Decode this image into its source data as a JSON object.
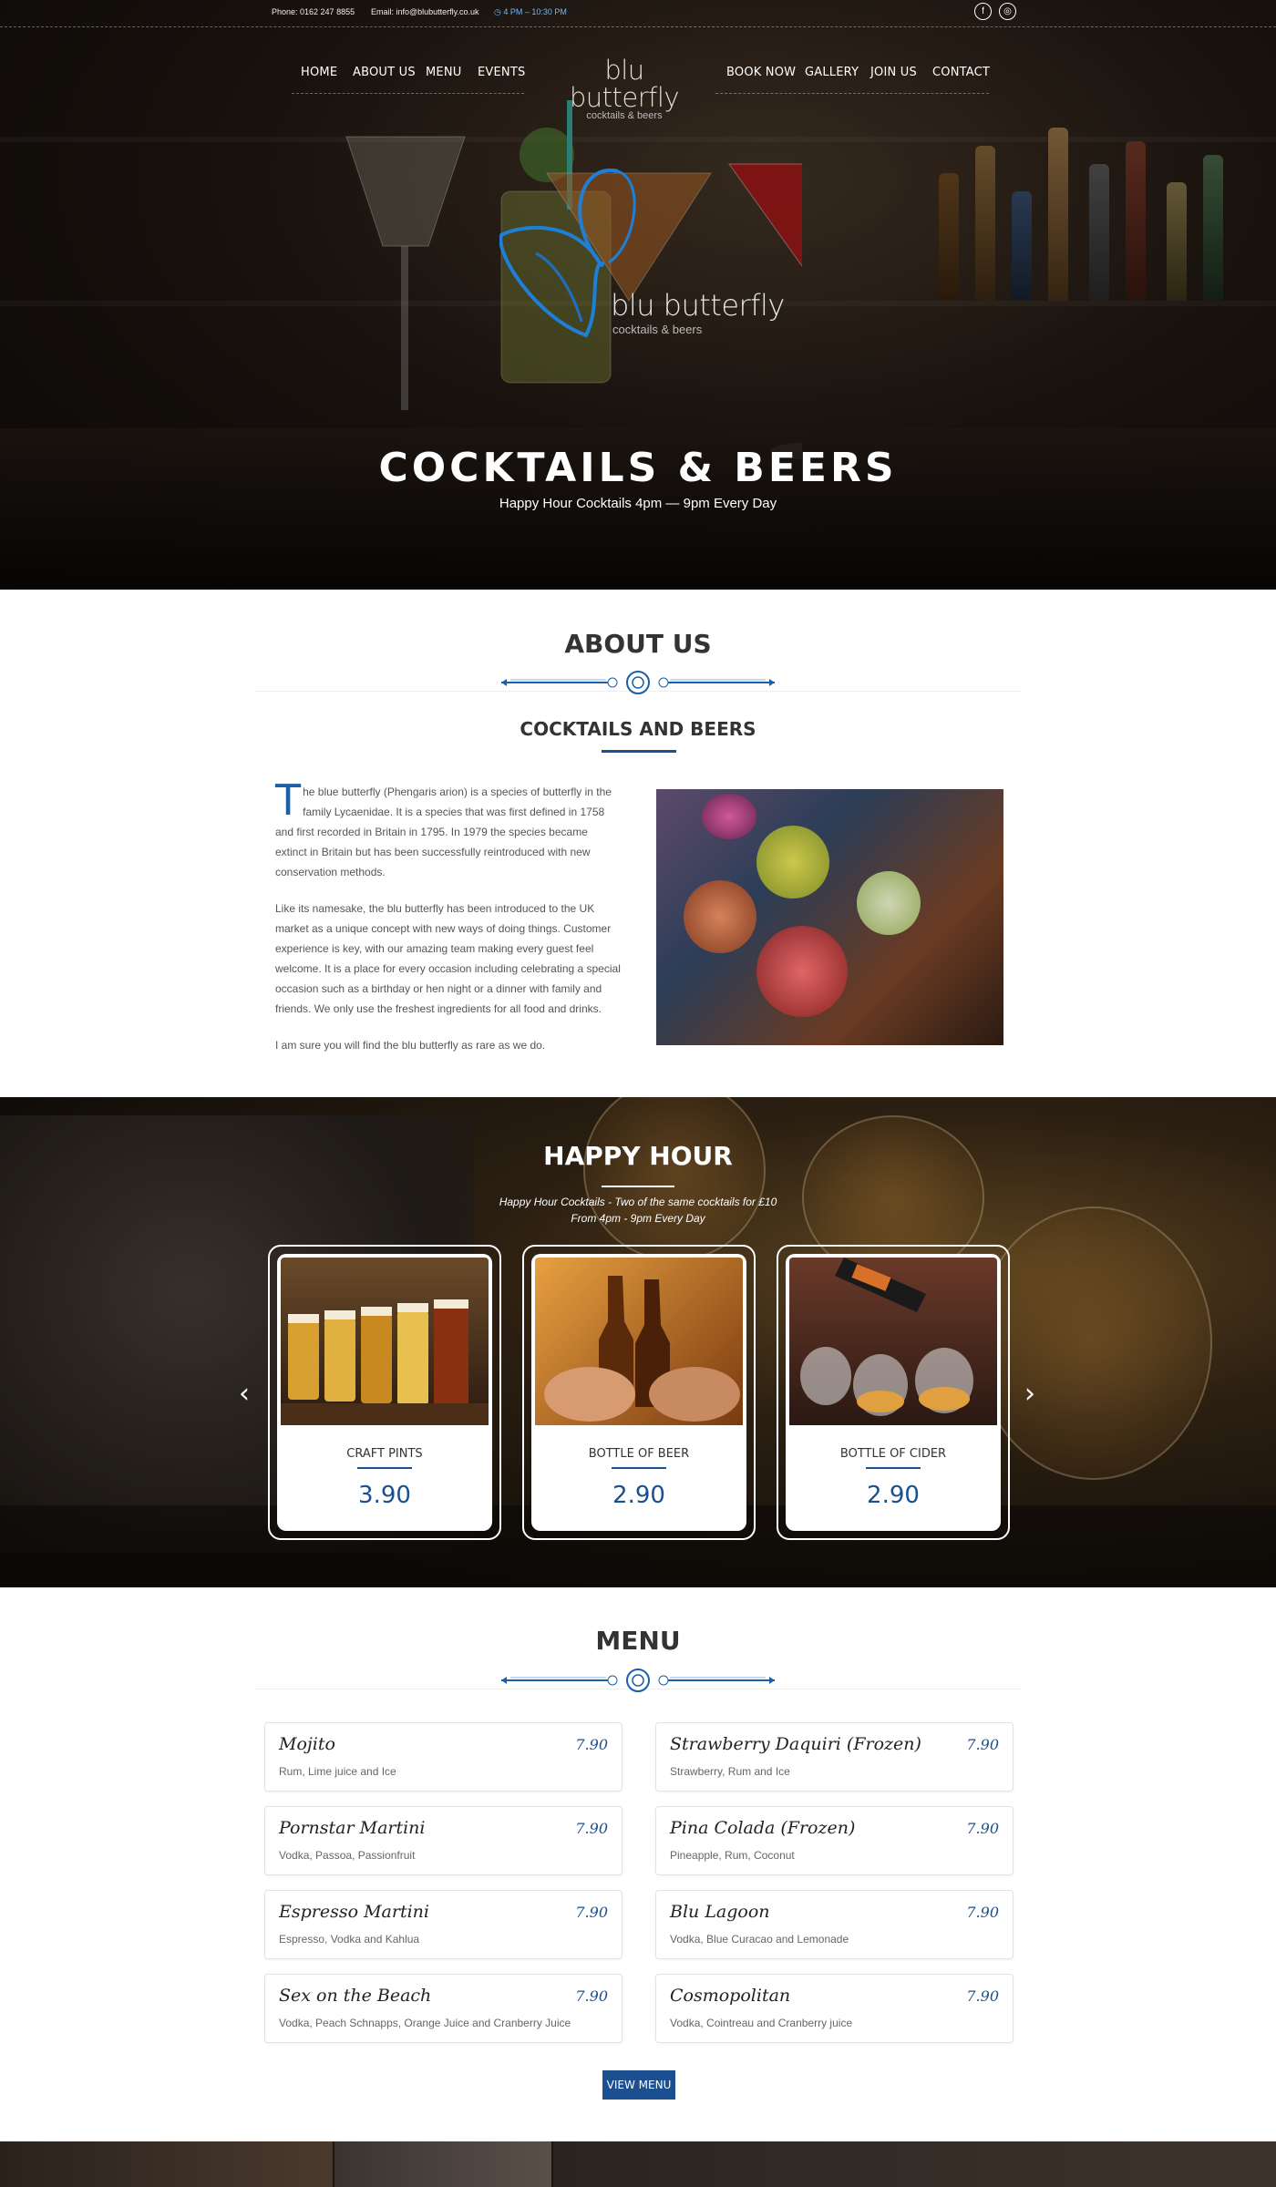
{
  "header": {
    "phone": "Phone: 0162 247 8855",
    "email": "Email: info@blubutterfly.co.uk",
    "hours": "◷ 4 PM – 10:30 PM",
    "social": [
      {
        "icon": "facebook-icon",
        "glyph": "f"
      },
      {
        "icon": "instagram-icon",
        "glyph": "◎"
      }
    ]
  },
  "nav": {
    "left": [
      "HOME",
      "ABOUT US",
      "MENU",
      "EVENTS"
    ],
    "right": [
      "BOOK NOW",
      "GALLERY",
      "JOIN US",
      "CONTACT"
    ],
    "logo_name": "blu butterfly",
    "logo_tagline": "cocktails & beers"
  },
  "hero": {
    "logo_name": "blu butterfly",
    "logo_tagline": "cocktails & beers",
    "title": "COCKTAILS & BEERS",
    "subtitle": "Happy Hour Cocktails 4pm — 9pm Every Day"
  },
  "about": {
    "title": "ABOUT US",
    "subtitle": "COCKTAILS AND BEERS",
    "dropcap": "T",
    "paragraph1": "he blue butterfly (Phengaris arion) is a species of butterfly in the family Lycaenidae. It is a species that was first defined in 1758 and first recorded in Britain in 1795. In 1979 the species became extinct in Britain but has been successfully reintroduced with new conservation methods.",
    "paragraph2": "Like its namesake, the blu butterfly has been introduced to the UK market as a unique concept with new ways of doing things. Customer experience is key, with our amazing team making every guest feel welcome. It is a place for every occasion including celebrating a special occasion such as a birthday or hen night or a dinner with family and friends. We only use the freshest ingredients for all food and drinks.",
    "paragraph3": "I am sure you will find the blu butterfly as rare as we do."
  },
  "happy_hour": {
    "title": "HAPPY HOUR",
    "line1": "Happy Hour Cocktails - Two of the same cocktails for £10",
    "line2": "From 4pm - 9pm Every Day",
    "prev_icon": "chevron-left-icon",
    "next_icon": "chevron-right-icon",
    "cards": [
      {
        "label": "CRAFT PINTS",
        "price": "3.90"
      },
      {
        "label": "BOTTLE OF BEER",
        "price": "2.90"
      },
      {
        "label": "BOTTLE OF CIDER",
        "price": "2.90"
      }
    ]
  },
  "menu": {
    "title": "MENU",
    "items": [
      {
        "name": "Mojito",
        "price": "7.90",
        "desc": "Rum, Lime juice and Ice"
      },
      {
        "name": "Strawberry Daquiri (Frozen)",
        "price": "7.90",
        "desc": "Strawberry, Rum and Ice"
      },
      {
        "name": "Pornstar Martini",
        "price": "7.90",
        "desc": "Vodka, Passoa, Passionfruit"
      },
      {
        "name": "Pina Colada (Frozen)",
        "price": "7.90",
        "desc": "Pineapple, Rum, Coconut"
      },
      {
        "name": "Espresso Martini",
        "price": "7.90",
        "desc": "Espresso, Vodka and Kahlua"
      },
      {
        "name": "Blu Lagoon",
        "price": "7.90",
        "desc": "Vodka, Blue Curacao and Lemonade"
      },
      {
        "name": "Sex on the Beach",
        "price": "7.90",
        "desc": "Vodka, Peach Schnapps, Orange Juice and Cranberry Juice"
      },
      {
        "name": "Cosmopolitan",
        "price": "7.90",
        "desc": "Vodka, Cointreau and Cranberry juice"
      }
    ],
    "button": "VIEW MENU"
  },
  "colors": {
    "accent_blue": "#1b4f8f",
    "dropcap_blue": "#1b5fa8",
    "hours_blue": "#6db8ff"
  }
}
